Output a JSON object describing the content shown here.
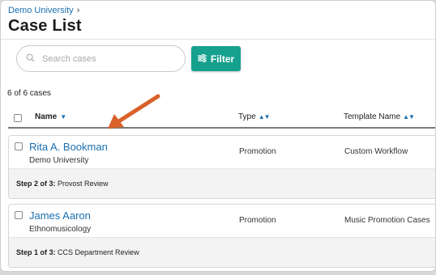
{
  "breadcrumb": {
    "parent": "Demo University",
    "separator": "›"
  },
  "page": {
    "title": "Case List"
  },
  "search": {
    "placeholder": "Search cases",
    "value": ""
  },
  "filter": {
    "label": "Filter",
    "icon": "sliders-icon",
    "color": "#16a08e"
  },
  "results": {
    "count_text": "6 of 6 cases"
  },
  "table": {
    "columns": [
      {
        "label": "Name",
        "sort": "descending"
      },
      {
        "label": "Type",
        "sort": "sortable"
      },
      {
        "label": "Template Name",
        "sort": "sortable"
      }
    ],
    "rows": [
      {
        "name": "Rita A. Bookman",
        "org": "Demo University",
        "type": "Promotion",
        "template": "Custom Workflow",
        "step_prefix": "Step 2 of 3:",
        "step_name": "Provost Review"
      },
      {
        "name": "James Aaron",
        "org": "Ethnomusicology",
        "type": "Promotion",
        "template": "Music Promotion Cases",
        "step_prefix": "Step 1 of 3:",
        "step_name": "CCS Department Review"
      }
    ]
  },
  "colors": {
    "link": "#1a6fb0",
    "annotation_arrow": "#d9622b"
  }
}
